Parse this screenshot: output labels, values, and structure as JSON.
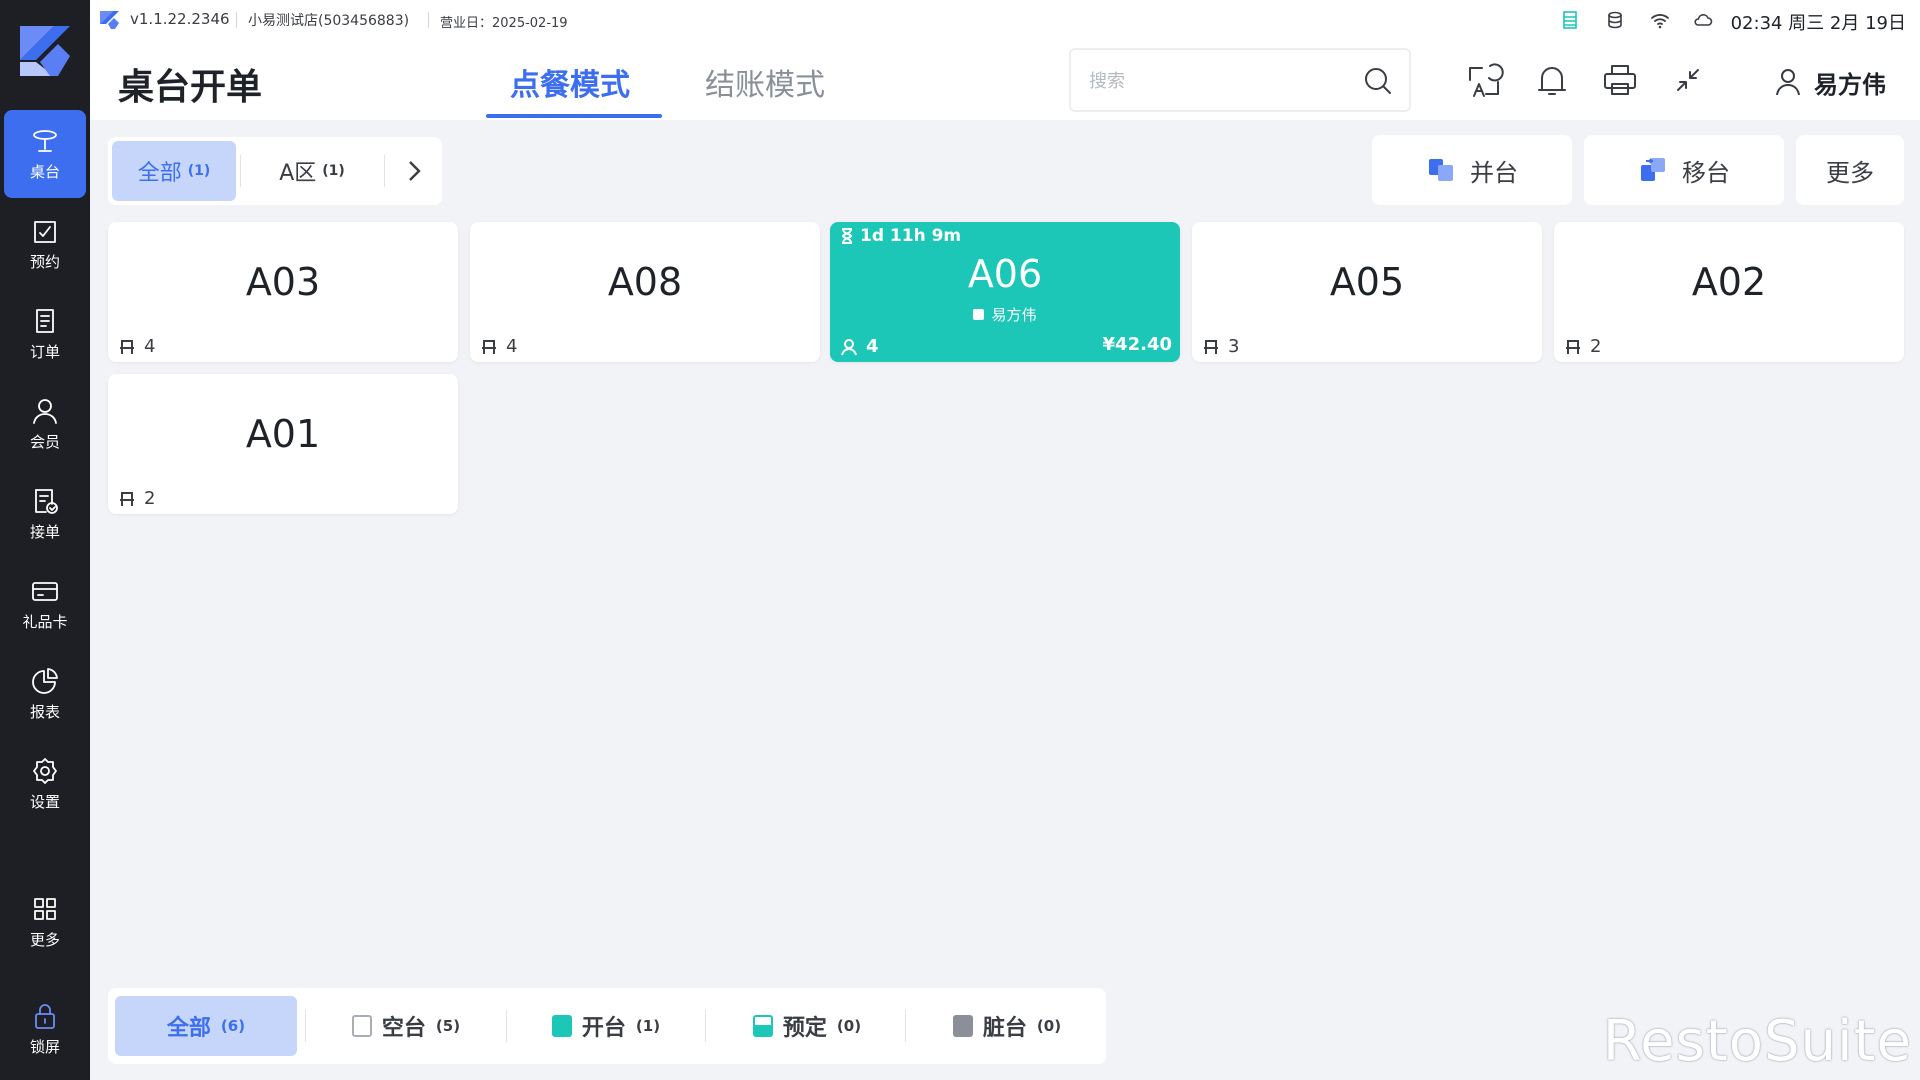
{
  "statusbar": {
    "version": "v1.1.22.2346",
    "store": "小易测试店(503456883)",
    "business_day": "营业日：2025-02-19",
    "clock": "02:34 周三 2月 19日"
  },
  "header": {
    "title": "桌台开单",
    "tabs": [
      {
        "label": "点餐模式",
        "active": true
      },
      {
        "label": "结账模式",
        "active": false
      }
    ],
    "search_placeholder": "搜索",
    "user_name": "易方伟"
  },
  "sidebar": {
    "items": [
      {
        "label": "桌台",
        "icon": "table-icon",
        "active": true
      },
      {
        "label": "预约",
        "icon": "reservation-icon"
      },
      {
        "label": "订单",
        "icon": "order-icon"
      },
      {
        "label": "会员",
        "icon": "member-icon"
      },
      {
        "label": "接单",
        "icon": "accept-order-icon"
      },
      {
        "label": "礼品卡",
        "icon": "gift-card-icon"
      },
      {
        "label": "报表",
        "icon": "report-icon"
      },
      {
        "label": "设置",
        "icon": "settings-icon"
      },
      {
        "label": "更多",
        "icon": "more-grid-icon"
      },
      {
        "label": "锁屏",
        "icon": "lock-icon"
      }
    ]
  },
  "areas": {
    "items": [
      {
        "label": "全部",
        "count": "(1)",
        "active": true
      },
      {
        "label": "A区",
        "count": "(1)",
        "active": false
      }
    ]
  },
  "actions": {
    "merge": "并台",
    "move": "移台",
    "more": "更多"
  },
  "tables": [
    {
      "name": "A03",
      "seats": "4",
      "status": "empty"
    },
    {
      "name": "A08",
      "seats": "4",
      "status": "empty"
    },
    {
      "name": "A06",
      "seats": "4",
      "status": "open",
      "timer": "1d 11h 9m",
      "waiter": "易方伟",
      "amount": "¥42.40"
    },
    {
      "name": "A05",
      "seats": "3",
      "status": "empty"
    },
    {
      "name": "A02",
      "seats": "2",
      "status": "empty"
    },
    {
      "name": "A01",
      "seats": "2",
      "status": "empty"
    }
  ],
  "status_filter": {
    "items": [
      {
        "label": "全部",
        "count": "(6)",
        "active": true
      },
      {
        "label": "空台",
        "count": "(5)"
      },
      {
        "label": "开台",
        "count": "(1)"
      },
      {
        "label": "预定",
        "count": "(0)"
      },
      {
        "label": "脏台",
        "count": "(0)"
      }
    ]
  },
  "colors": {
    "accent": "#3d6ef0",
    "open_table": "#1cc7b8",
    "dirty": "#8a8f99",
    "sidebar_bg": "#1e1f24"
  },
  "watermark": "RestoSuite"
}
